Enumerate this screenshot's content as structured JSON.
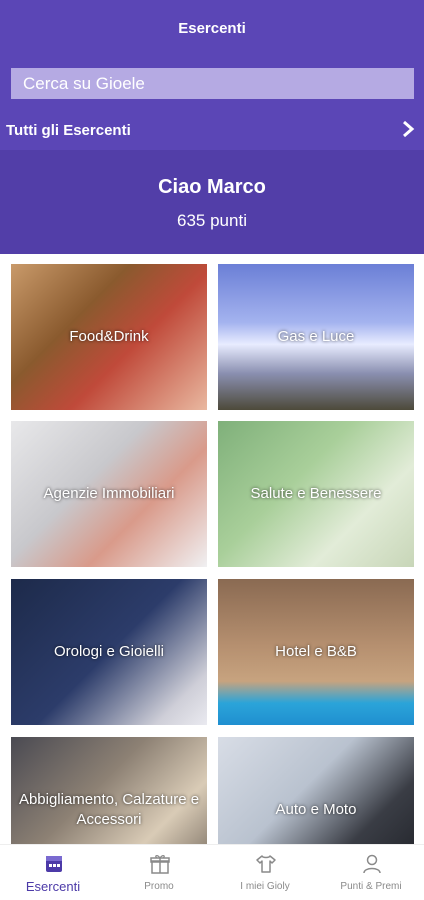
{
  "header": {
    "title": "Esercenti",
    "search_placeholder": "Cerca su Gioele",
    "all_merchants_label": "Tutti gli Esercenti"
  },
  "greeting": {
    "name": "Ciao Marco",
    "points": "635 punti"
  },
  "categories": [
    {
      "label": "Food&Drink"
    },
    {
      "label": "Gas e Luce"
    },
    {
      "label": "Agenzie Immobiliari"
    },
    {
      "label": "Salute e Benessere"
    },
    {
      "label": "Orologi e Gioielli"
    },
    {
      "label": "Hotel e B&B"
    },
    {
      "label": "Abbigliamento, Calzature e Accessori"
    },
    {
      "label": "Auto e Moto"
    }
  ],
  "nav": {
    "items": [
      {
        "label": "Esercenti",
        "icon": "store-icon",
        "active": true
      },
      {
        "label": "Promo",
        "icon": "gift-icon",
        "active": false
      },
      {
        "label": "I miei Gioly",
        "icon": "shirt-icon",
        "active": false
      },
      {
        "label": "Punti & Premi",
        "icon": "user-icon",
        "active": false
      }
    ]
  },
  "colors": {
    "header": "#5b46b6",
    "greeting": "#523ea8",
    "accent": "#4c3aa8"
  }
}
